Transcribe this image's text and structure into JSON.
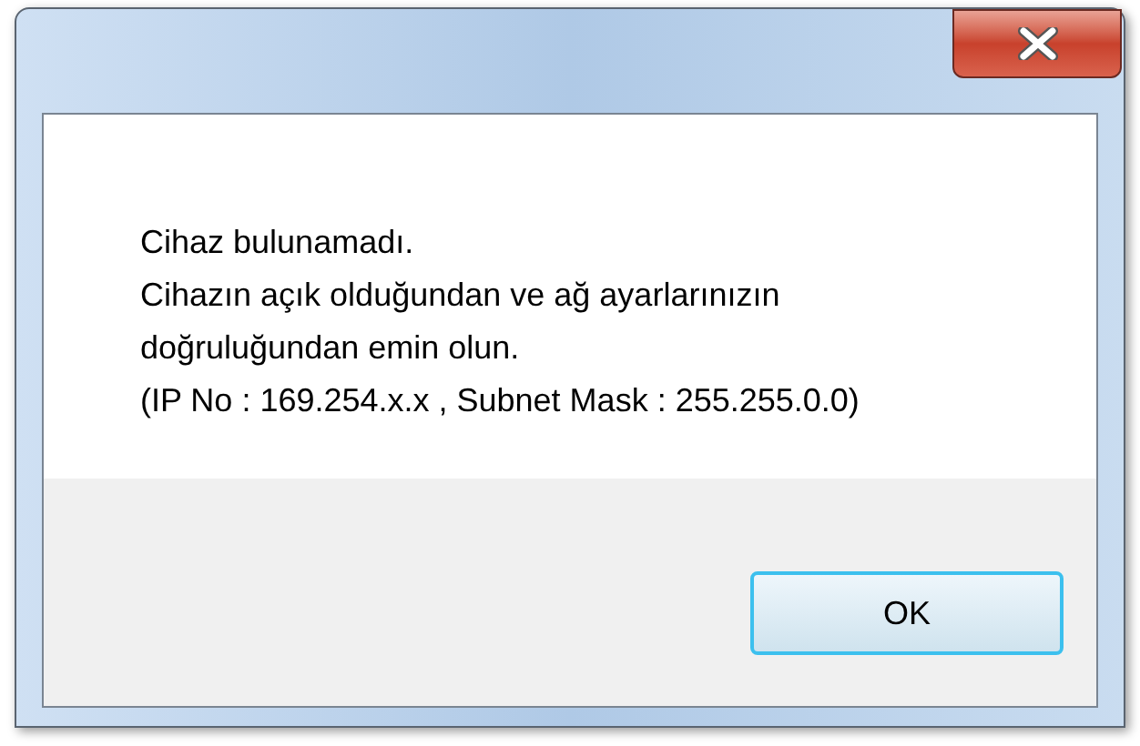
{
  "message": {
    "lines": [
      "Cihaz bulunamadı.",
      "Cihazın açık olduğundan ve ağ ayarlarınızın doğruluğundan emin olun.",
      "(IP No : 169.254.x.x , Subnet Mask : 255.255.0.0)"
    ]
  },
  "buttons": [
    {
      "label": "OK",
      "selected": true
    }
  ]
}
